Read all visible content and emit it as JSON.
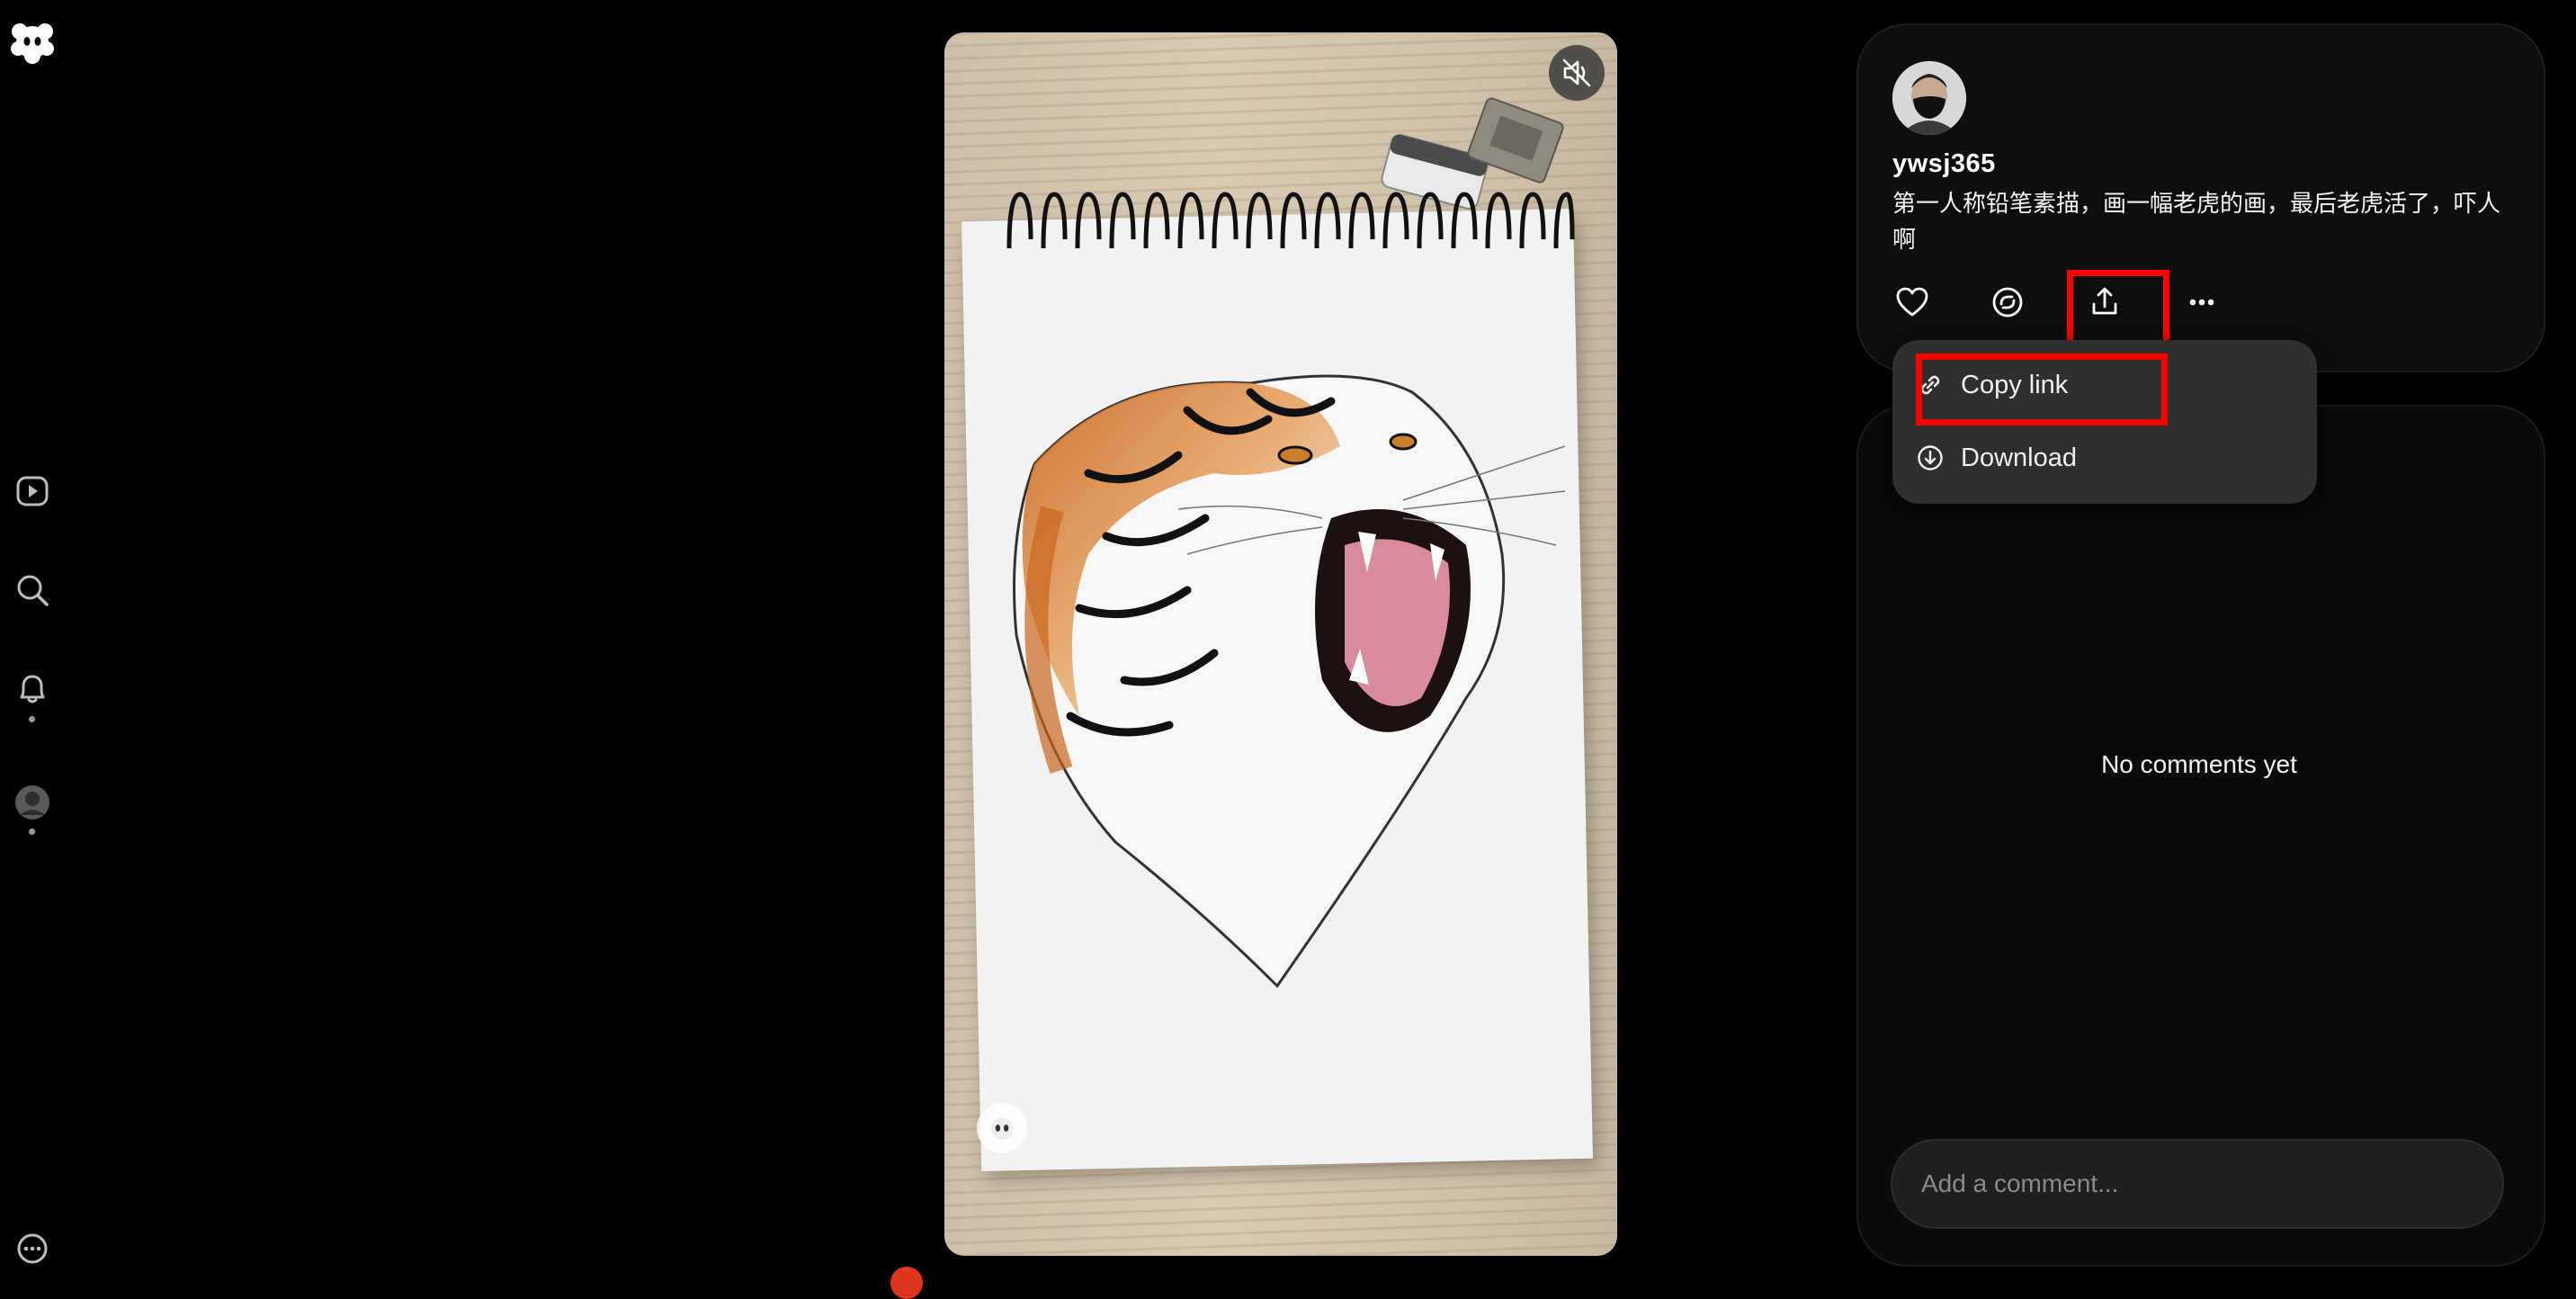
{
  "nav": {
    "items": [
      {
        "icon": "video-feed-icon"
      },
      {
        "icon": "search-icon"
      },
      {
        "icon": "bell-icon"
      },
      {
        "icon": "profile-avatar"
      }
    ],
    "footer_icon": "more-options-icon"
  },
  "video": {
    "mute_icon": "volume-muted-icon",
    "subject": "pencil sketch of roaring tiger on spiral notepad"
  },
  "post": {
    "username": "ywsj365",
    "caption": "第一人称铅笔素描，画一幅老虎的画，最后老虎活了，吓人啊",
    "actions": [
      {
        "icon": "heart-icon"
      },
      {
        "icon": "repost-icon"
      },
      {
        "icon": "share-icon"
      },
      {
        "icon": "ellipsis-icon"
      }
    ]
  },
  "share_menu": {
    "items": [
      {
        "label": "Copy link",
        "icon": "link-icon"
      },
      {
        "label": "Download",
        "icon": "download-icon"
      }
    ]
  },
  "comments": {
    "empty_text": "No comments yet",
    "input_placeholder": "Add a comment..."
  },
  "colors": {
    "background": "#000000",
    "card": "#0e0e0e",
    "menu": "#2f2f2f",
    "highlight": "#ff0000"
  }
}
